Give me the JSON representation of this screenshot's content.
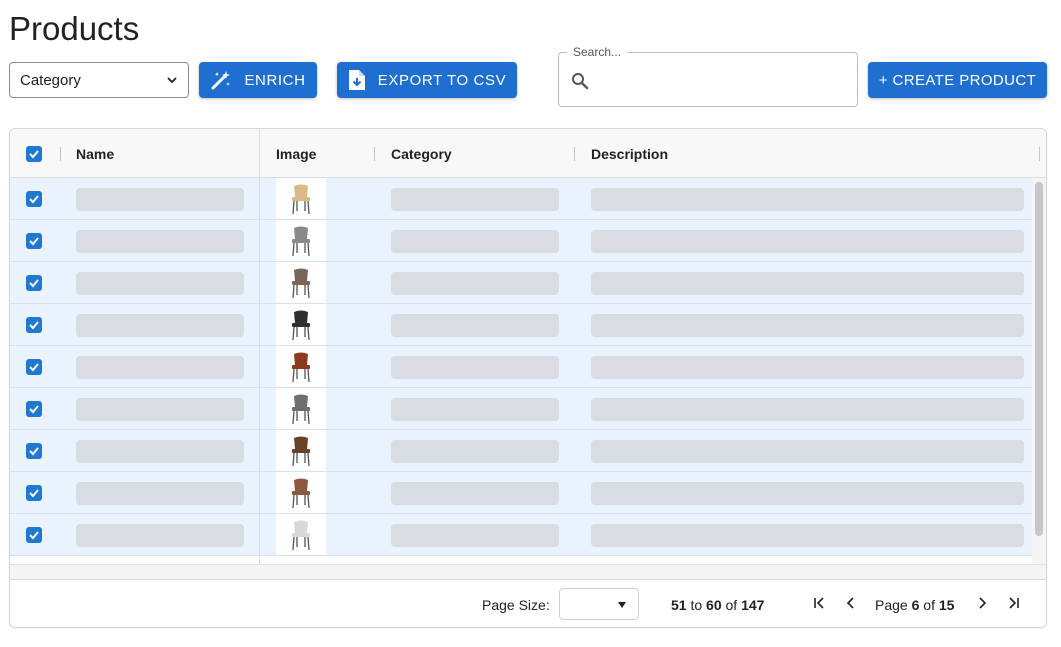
{
  "page": {
    "title": "Products"
  },
  "toolbar": {
    "category_select_value": "Category",
    "enrich_label": "ENRICH",
    "export_label": "EXPORT TO CSV",
    "create_label": "+ CREATE PRODUCT",
    "search_label": "Search...",
    "search_value": ""
  },
  "grid": {
    "columns": [
      "Name",
      "Image",
      "Category",
      "Description"
    ],
    "header_checkbox_checked": true,
    "rows": [
      {
        "selected": true,
        "image": "chair-beige-icon",
        "color": "#d9b98a"
      },
      {
        "selected": true,
        "image": "armchair-gray-icon",
        "color": "#8a8a8a"
      },
      {
        "selected": true,
        "image": "chair-wood-icon",
        "color": "#7a6656"
      },
      {
        "selected": true,
        "image": "chair-black-icon",
        "color": "#2f2f2f"
      },
      {
        "selected": true,
        "image": "chair-brown-icon",
        "color": "#8a3a1e"
      },
      {
        "selected": true,
        "image": "chair-wire-icon",
        "color": "#6e6e6e"
      },
      {
        "selected": true,
        "image": "chair-walnut-icon",
        "color": "#6b4226"
      },
      {
        "selected": true,
        "image": "chair-oak-icon",
        "color": "#8b5a3c"
      },
      {
        "selected": true,
        "image": "chair-white-icon",
        "color": "#d9d9d9"
      }
    ]
  },
  "footer": {
    "page_size_label": "Page Size:",
    "page_size_value": "",
    "range_from": "51",
    "range_to_word": "to",
    "range_to": "60",
    "range_of_word": "of",
    "range_total": "147",
    "page_word": "Page",
    "page_current": "6",
    "page_of_word": "of",
    "page_total": "15"
  },
  "colors": {
    "accent": "#1f6fd1",
    "row_selected": "#eaf3fd",
    "skeleton": "#d8dde4"
  }
}
